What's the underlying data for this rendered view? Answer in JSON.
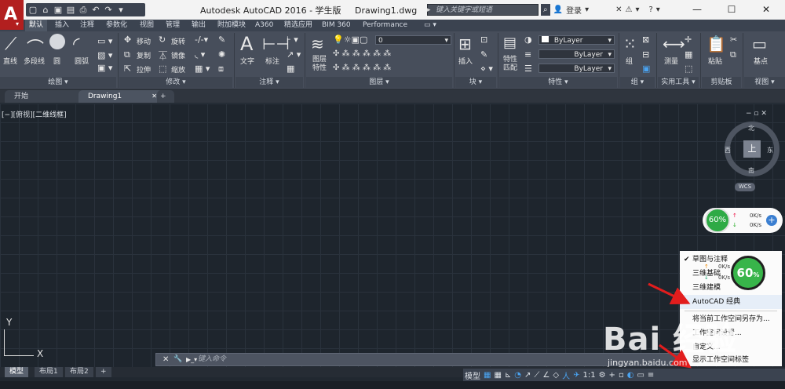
{
  "app": {
    "title": "Autodesk AutoCAD 2016 - 学生版     Drawing1.dwg",
    "search_placeholder": "键入关键字或短语",
    "login_label": "登录",
    "help_label": "?",
    "win_min": "—",
    "win_max": "☐",
    "win_close": "✕",
    "logo_letter": "A",
    "brand_red": "#b21f1f"
  },
  "qat": {
    "icons": [
      "▢",
      "⌂",
      "▣",
      "▤",
      "⎙",
      "↶",
      "↷",
      "▾"
    ]
  },
  "ribbon_tabs": [
    "默认",
    "插入",
    "注释",
    "参数化",
    "视图",
    "管理",
    "输出",
    "附加模块",
    "A360",
    "精选应用",
    "BIM 360",
    "Performance",
    "▭ ▾"
  ],
  "ribbon": {
    "draw": {
      "title": "绘图 ▾",
      "line": "直线",
      "polyline": "多段线",
      "circle": "圆",
      "arc": "圆弧"
    },
    "modify": {
      "title": "修改 ▾",
      "move": "移动",
      "rotate": "旋转",
      "copy": "复制",
      "mirror": "镜像",
      "stretch": "拉伸",
      "scale": "缩放"
    },
    "annotation": {
      "title": "注释 ▾",
      "text": "文字",
      "dimension": "标注"
    },
    "layers": {
      "title": "图层 ▾",
      "layer_props": "图层\n特性",
      "current_layer": "0"
    },
    "block": {
      "title": "块 ▾",
      "insert": "插入"
    },
    "properties": {
      "title": "特性 ▾",
      "match": "特性\n匹配",
      "color": "ByLayer",
      "linetype": "ByLayer",
      "lineweight": "ByLayer"
    },
    "groups": {
      "title": "组 ▾",
      "group": "组"
    },
    "utilities": {
      "title": "实用工具 ▾",
      "measure": "测量"
    },
    "clipboard": {
      "title": "剪贴板",
      "paste": "粘贴"
    },
    "view": {
      "title": "视图 ▾",
      "base": "基点"
    }
  },
  "doc_tabs": [
    "开始",
    "Drawing1",
    "+"
  ],
  "viewport_label": "[−][俯视][二维线框]",
  "viewport_controls": "−  ▫  ✕",
  "viewcube": {
    "north": "北",
    "south": "南",
    "east": "东",
    "west": "西",
    "face": "上",
    "wcs": "WCS"
  },
  "ucs": {
    "x": "X",
    "y": "Y"
  },
  "net_widget": {
    "percent": "60%",
    "up": "0K/s",
    "down": "0K/s"
  },
  "command_line": {
    "placeholder": "键入命令",
    "close": "✕",
    "settings": "🔧",
    "prompt": "▶_▾"
  },
  "layout_tabs": [
    "模型",
    "布局1",
    "布局2",
    "+"
  ],
  "status_bar": {
    "model": "模型",
    "scale": "1:1",
    "icons": [
      "▦",
      "▦",
      "⊾",
      "◔",
      "↗",
      "⟋",
      "∠",
      "◇",
      "人",
      "✈",
      "⚙",
      "+",
      "▫",
      "◐",
      "▭",
      "≡"
    ]
  },
  "workspace_menu": {
    "items": [
      "草图与注释",
      "三维基础",
      "三维建模",
      "AutoCAD 经典",
      "将当前工作空间另存为...",
      "工作空间设置...",
      "自定义...",
      "显示工作空间标签"
    ],
    "checked_index": 0,
    "highlighted_index": 3
  },
  "speed_overlay": {
    "percent": "60",
    "up": "0K/s",
    "down": "0K/s"
  },
  "watermark": {
    "text": "Bai 经验",
    "sub": "jingyan.baidu.com"
  }
}
